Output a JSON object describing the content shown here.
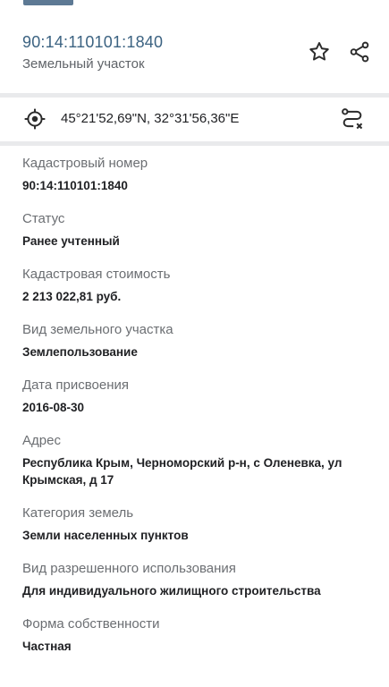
{
  "header": {
    "cadastral_number": "90:14:110101:1840",
    "object_type": "Земельный участок"
  },
  "location": {
    "coordinates": "45°21'52,69\"N, 32°31'56,36\"E"
  },
  "icons": {
    "favorite": "star-icon",
    "share": "share-icon",
    "locate": "crosshair-icon",
    "route": "route-clear-icon"
  },
  "colors": {
    "accent": "#3c6382",
    "label": "#6b6e72",
    "divider": "#e9eaec"
  },
  "fields": [
    {
      "label": "Кадастровый номер",
      "value": "90:14:110101:1840"
    },
    {
      "label": "Статус",
      "value": "Ранее учтенный"
    },
    {
      "label": "Кадастровая стоимость",
      "value": "2 213 022,81 руб."
    },
    {
      "label": "Вид земельного участка",
      "value": "Землепользование"
    },
    {
      "label": "Дата присвоения",
      "value": "2016-08-30"
    },
    {
      "label": "Адрес",
      "value": "Республика Крым, Черноморский р-н, с Оленевка, ул Крымская, д 17"
    },
    {
      "label": "Категория земель",
      "value": "Земли населенных пунктов"
    },
    {
      "label": "Вид разрешенного использования",
      "value": "Для индивидуального жилищного строительства"
    },
    {
      "label": "Форма собственности",
      "value": "Частная"
    }
  ]
}
